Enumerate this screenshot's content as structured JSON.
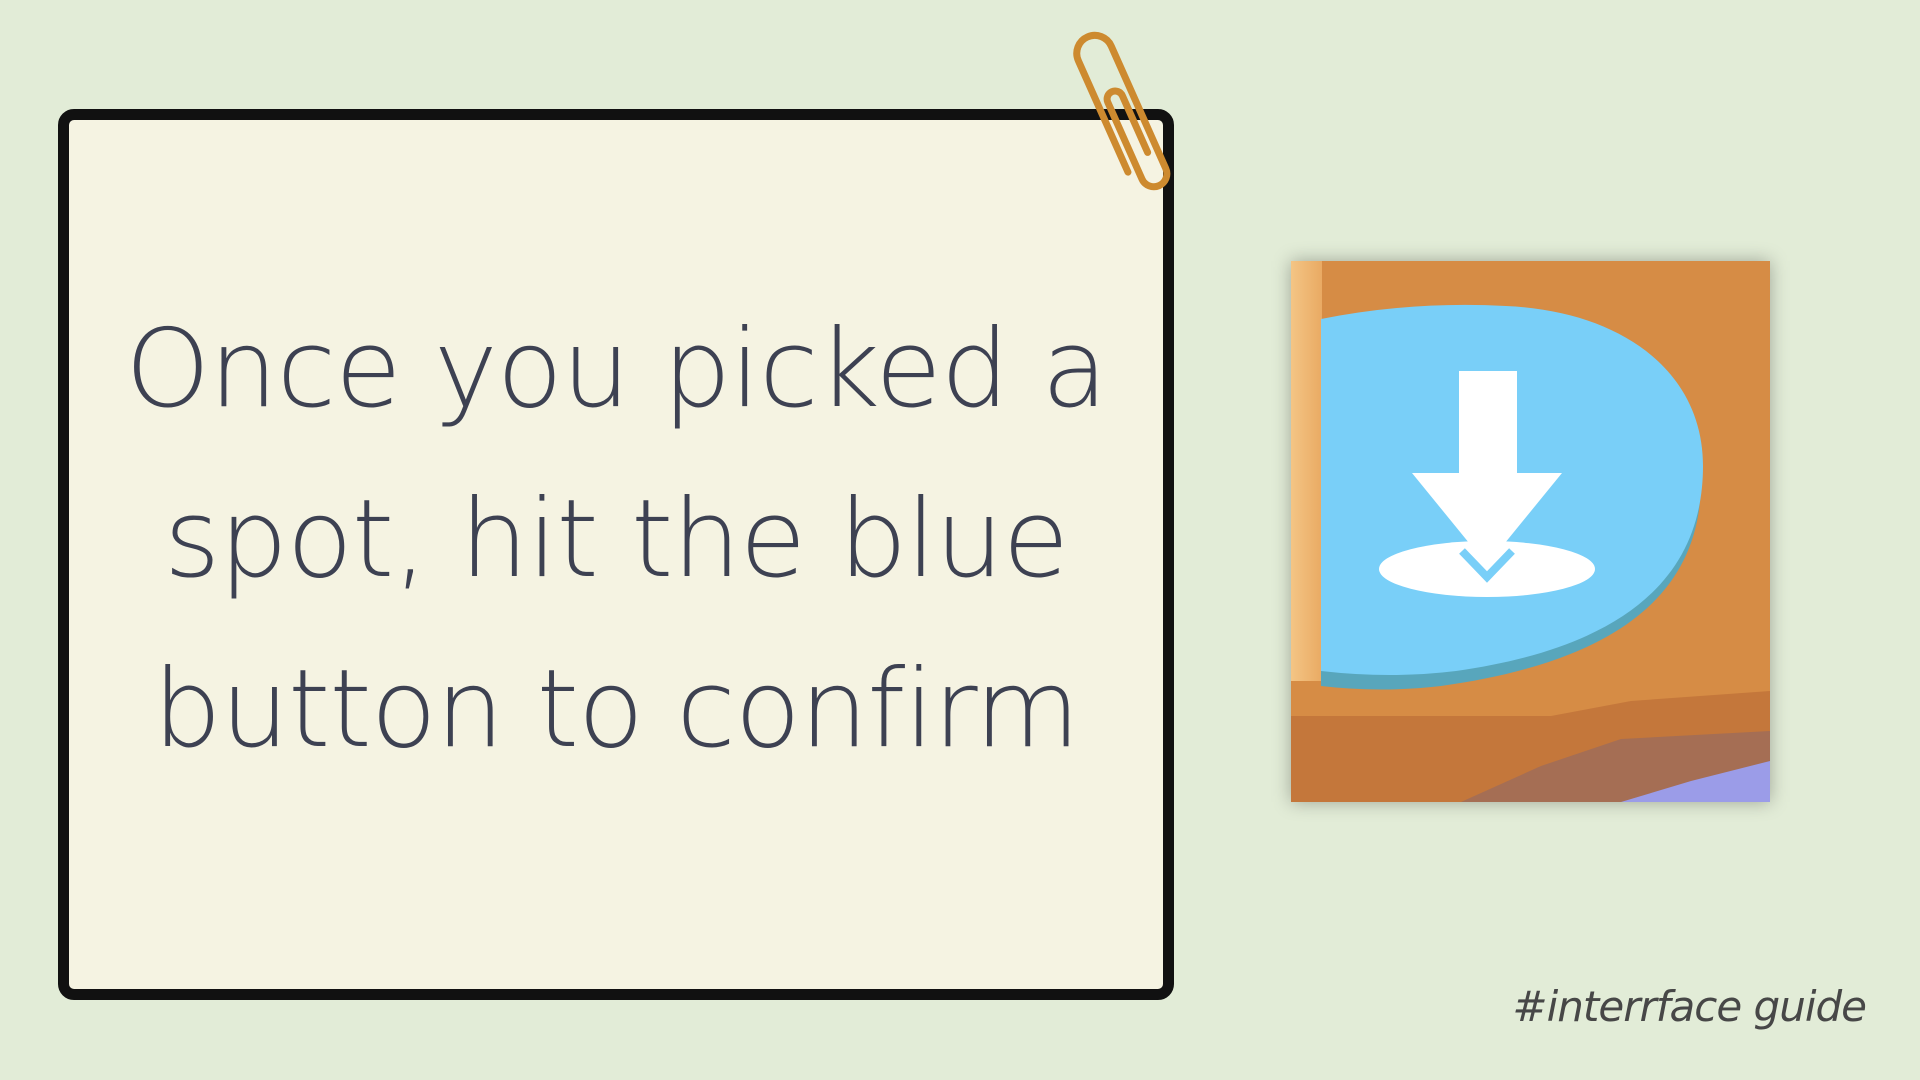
{
  "note": {
    "line1": "Once you picked a",
    "line2": "spot, hit the blue",
    "line3": "button to confirm"
  },
  "icons": {
    "paperclip": "paperclip-icon",
    "confirm_button": "download-arrow-icon"
  },
  "colors": {
    "background": "#e2ecd7",
    "card": "#f5f3e2",
    "card_border": "#111111",
    "text": "#3d4152",
    "paperclip": "#cd8a2f",
    "button_blue": "#79cff8",
    "panel_orange": "#d68c45"
  },
  "footer": {
    "hashtag": "#interrface guide"
  }
}
